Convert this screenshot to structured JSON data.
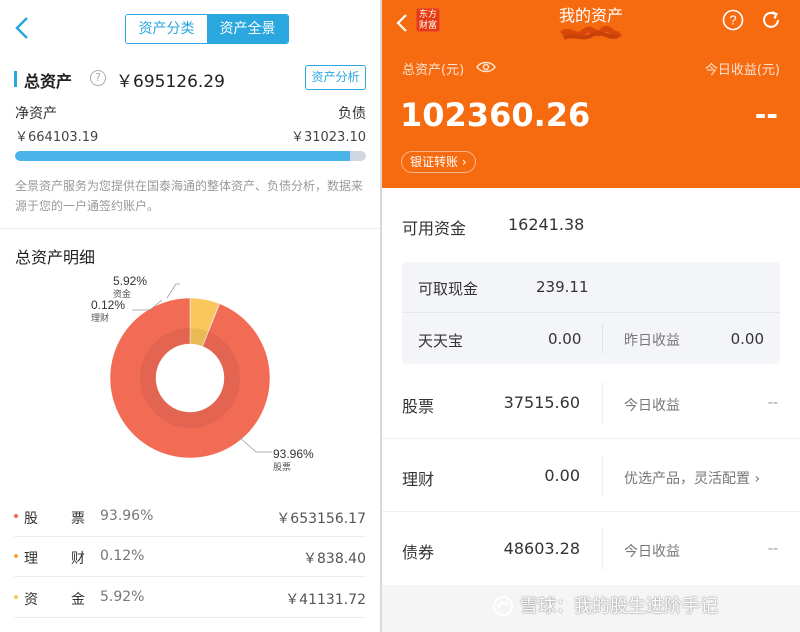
{
  "left": {
    "tabs": [
      {
        "label": "资产分类",
        "active": false
      },
      {
        "label": "资产全景",
        "active": true
      }
    ],
    "total_label": "总资产",
    "total_value": "￥695126.29",
    "analysis_button": "资产分析",
    "net_label": "净资产",
    "net_value": "￥664103.19",
    "debt_label": "负债",
    "debt_value": "￥31023.10",
    "net_ratio": 0.955,
    "description": "全景资产服务为您提供在国泰海通的整体资产、负债分析，数据来源于您的一户通签约账户。",
    "section_title": "总资产明细",
    "chart_data": {
      "type": "pie",
      "donut": true,
      "slices": [
        {
          "name": "股票",
          "value": 93.96,
          "label": "93.96%",
          "color": "#f26b55"
        },
        {
          "name": "理财",
          "value": 0.12,
          "label": "0.12%",
          "color": "#b8b8b8"
        },
        {
          "name": "资金",
          "value": 5.92,
          "label": "5.92%",
          "color": "#f9c75b"
        }
      ]
    },
    "rows": [
      {
        "c1": "股",
        "c2": "票",
        "pct": "93.96%",
        "amount": "￥653156.17",
        "color": "#f26b55"
      },
      {
        "c1": "理",
        "c2": "财",
        "pct": "0.12%",
        "amount": "￥838.40",
        "color": "#f7a542"
      },
      {
        "c1": "资",
        "c2": "金",
        "pct": "5.92%",
        "amount": "￥41131.72",
        "color": "#f9c75b"
      }
    ]
  },
  "right": {
    "logo_text": "东方财富",
    "title": "我的资产",
    "total_label": "总资产(元)",
    "today_label": "今日收益(元)",
    "total_value": "102360.26",
    "today_value": "--",
    "transfer_button": "银证转账 ›",
    "available_label": "可用资金",
    "available_value": "16241.38",
    "withdrawable_label": "可取现金",
    "withdrawable_value": "239.11",
    "ttb_label": "天天宝",
    "ttb_value": "0.00",
    "yesterday_label": "昨日收益",
    "yesterday_value": "0.00",
    "stock_label": "股票",
    "stock_value": "37515.60",
    "stock_today_label": "今日收益",
    "stock_today_value": "--",
    "wealth_label": "理财",
    "wealth_value": "0.00",
    "wealth_link": "优选产品，灵活配置 ›",
    "bond_label": "债券",
    "bond_value": "48603.28",
    "bond_today_label": "今日收益",
    "bond_today_value": "--",
    "watermark": "雪球：我的股生进阶手记"
  }
}
